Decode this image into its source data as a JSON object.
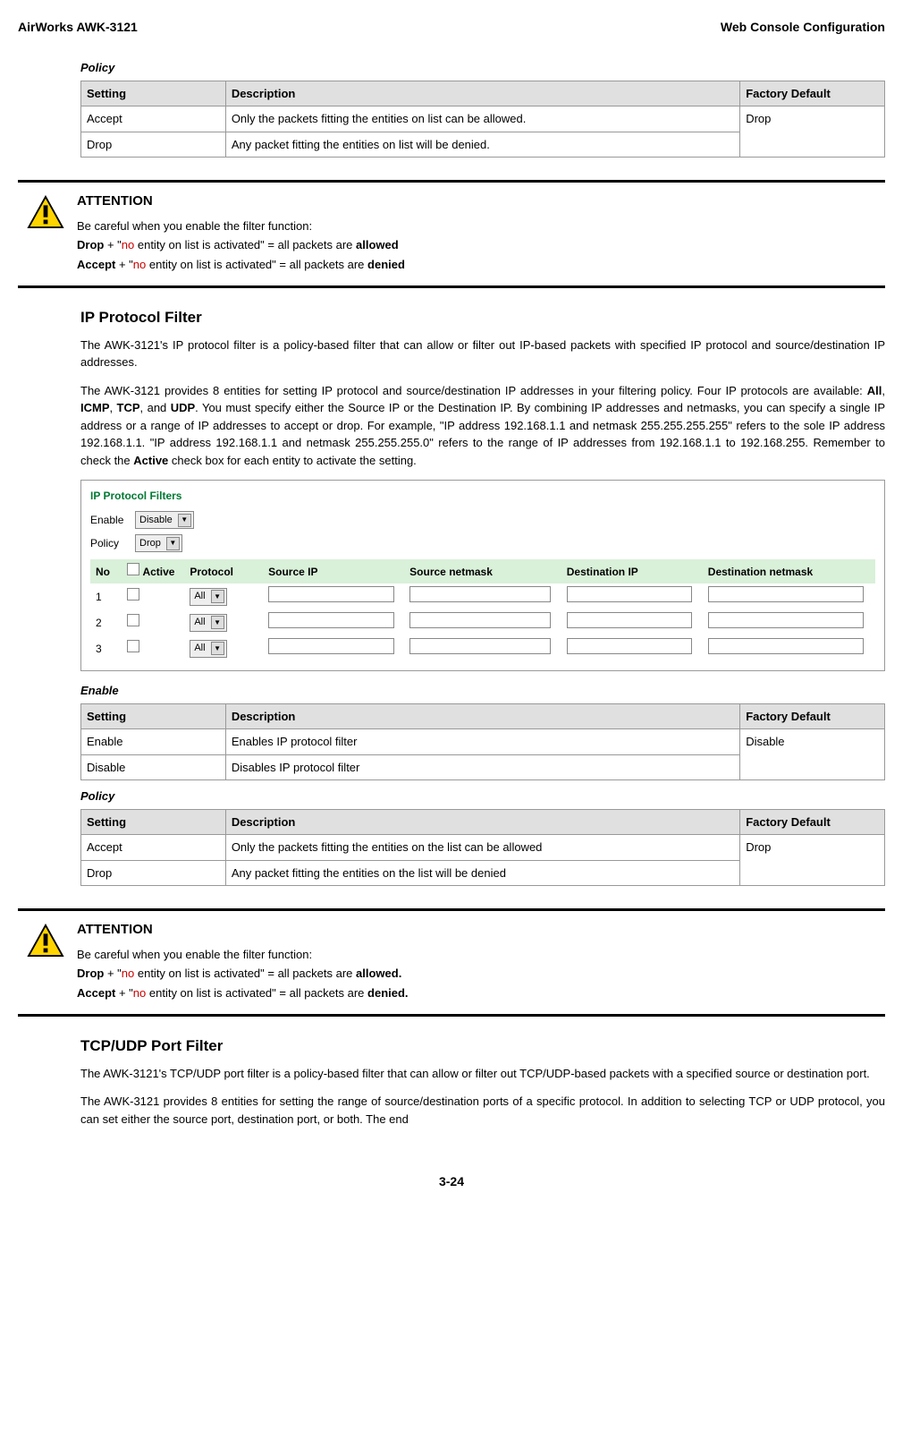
{
  "header": {
    "left": "AirWorks AWK-3121",
    "right": "Web Console Configuration"
  },
  "policy1": {
    "label": "Policy",
    "head": {
      "c1": "Setting",
      "c2": "Description",
      "c3": "Factory Default"
    },
    "r1": {
      "c1": "Accept",
      "c2": "Only the packets fitting the entities on list can be allowed.",
      "c3": "Drop"
    },
    "r2": {
      "c1": "Drop",
      "c2": "Any packet fitting the entities on list will be denied."
    }
  },
  "attn1": {
    "title": "ATTENTION",
    "l1": "Be careful when you enable the filter function:",
    "l2a": "Drop",
    "l2b": " + \"",
    "l2c": "no",
    "l2d": " entity on list is activated\" = all packets are ",
    "l2e": "allowed",
    "l3a": "Accept",
    "l3b": " + \"",
    "l3c": "no",
    "l3d": " entity on list is activated\" = all packets are ",
    "l3e": "denied"
  },
  "ipfilter": {
    "title": "IP Protocol Filter",
    "p1": "The AWK-3121's IP protocol filter is a policy-based filter that can allow or filter out IP-based packets with specified IP protocol and source/destination IP addresses.",
    "p2a": "The AWK-3121 provides 8 entities for setting IP protocol and source/destination IP addresses in your filtering policy. Four IP protocols are available: ",
    "p2_all": "All",
    "p2s1": ", ",
    "p2_icmp": "ICMP",
    "p2s2": ", ",
    "p2_tcp": "TCP",
    "p2s3": ", and ",
    "p2_udp": "UDP",
    "p2b": ". You must specify either the Source IP or the Destination IP. By combining IP addresses and netmasks, you can specify a single IP address or a range of IP addresses to accept or drop. For example, \"IP address 192.168.1.1 and netmask 255.255.255.255\" refers to the sole IP address 192.168.1.1. \"IP address 192.168.1.1 and netmask 255.255.255.0\" refers to the range of IP addresses from 192.168.1.1 to 192.168.255. Remember to check the ",
    "p2_active": "Active",
    "p2c": " check box for each entity to activate the setting."
  },
  "screenshot": {
    "title": "IP Protocol Filters",
    "enable_label": "Enable",
    "enable_value": "Disable",
    "policy_label": "Policy",
    "policy_value": "Drop",
    "th": {
      "no": "No",
      "active": "Active",
      "protocol": "Protocol",
      "sip": "Source IP",
      "snm": "Source netmask",
      "dip": "Destination IP",
      "dnm": "Destination netmask"
    },
    "rows": {
      "r1": "1",
      "r2": "2",
      "r3": "3"
    },
    "proto": "All"
  },
  "enable_tbl": {
    "label": "Enable",
    "head": {
      "c1": "Setting",
      "c2": "Description",
      "c3": "Factory Default"
    },
    "r1": {
      "c1": "Enable",
      "c2": "Enables IP protocol filter",
      "c3": "Disable"
    },
    "r2": {
      "c1": "Disable",
      "c2": "Disables IP protocol filter"
    }
  },
  "policy2": {
    "label": "Policy",
    "head": {
      "c1": "Setting",
      "c2": "Description",
      "c3": "Factory Default"
    },
    "r1": {
      "c1": "Accept",
      "c2": "Only the packets fitting the entities on the list can be allowed",
      "c3": "Drop"
    },
    "r2": {
      "c1": "Drop",
      "c2": "Any packet fitting the entities on the list will be denied"
    }
  },
  "attn2": {
    "title": "ATTENTION",
    "l1": "Be careful when you enable the filter function:",
    "l2a": "Drop",
    "l2b": " + \"",
    "l2c": "no",
    "l2d": " entity on list is activated\" = all packets are ",
    "l2e": "allowed.",
    "l3a": "Accept",
    "l3b": " + \"",
    "l3c": "no",
    "l3d": " entity on list is activated\" = all packets are ",
    "l3e": "denied."
  },
  "tcpudp": {
    "title": "TCP/UDP Port Filter",
    "p1": "The AWK-3121's TCP/UDP port filter is a policy-based filter that can allow or filter out TCP/UDP-based packets with a specified source or destination port.",
    "p2": "The AWK-3121 provides 8 entities for setting the range of source/destination ports of a specific protocol. In addition to selecting TCP or UDP protocol, you can set either the source port, destination port, or both. The end"
  },
  "footer": "3-24"
}
